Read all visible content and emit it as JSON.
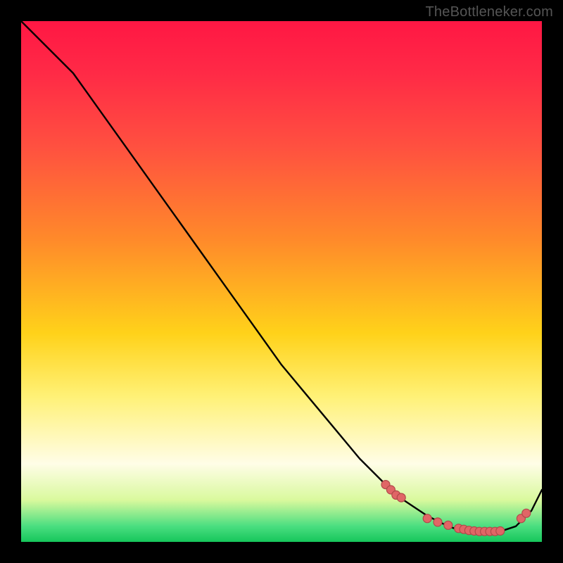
{
  "watermark": "TheBottleneker.com",
  "colors": {
    "dot_fill": "#e06666",
    "dot_stroke": "#b04a4a",
    "curve": "#000000"
  },
  "chart_data": {
    "type": "line",
    "title": "",
    "xlabel": "",
    "ylabel": "",
    "xlim": [
      0,
      100
    ],
    "ylim": [
      0,
      100
    ],
    "legend": false,
    "grid": false,
    "series": [
      {
        "name": "curve",
        "x": [
          0,
          5,
          10,
          15,
          20,
          25,
          30,
          35,
          40,
          45,
          50,
          55,
          60,
          65,
          70,
          72,
          75,
          78,
          80,
          82,
          85,
          88,
          90,
          92,
          95,
          98,
          100
        ],
        "y": [
          100,
          95,
          90,
          83,
          76,
          69,
          62,
          55,
          48,
          41,
          34,
          28,
          22,
          16,
          11,
          9,
          7,
          5,
          4,
          3,
          2,
          2,
          2,
          2,
          3,
          6,
          10
        ]
      }
    ],
    "dots": {
      "name": "highlight-points",
      "x": [
        70,
        71,
        72,
        73,
        78,
        80,
        82,
        84,
        85,
        86,
        87,
        88,
        89,
        90,
        91,
        92,
        96,
        97
      ],
      "y": [
        11,
        10,
        9,
        8.5,
        4.5,
        3.8,
        3.2,
        2.6,
        2.4,
        2.2,
        2.1,
        2.0,
        2.0,
        2.0,
        2.0,
        2.1,
        4.5,
        5.5
      ]
    }
  }
}
